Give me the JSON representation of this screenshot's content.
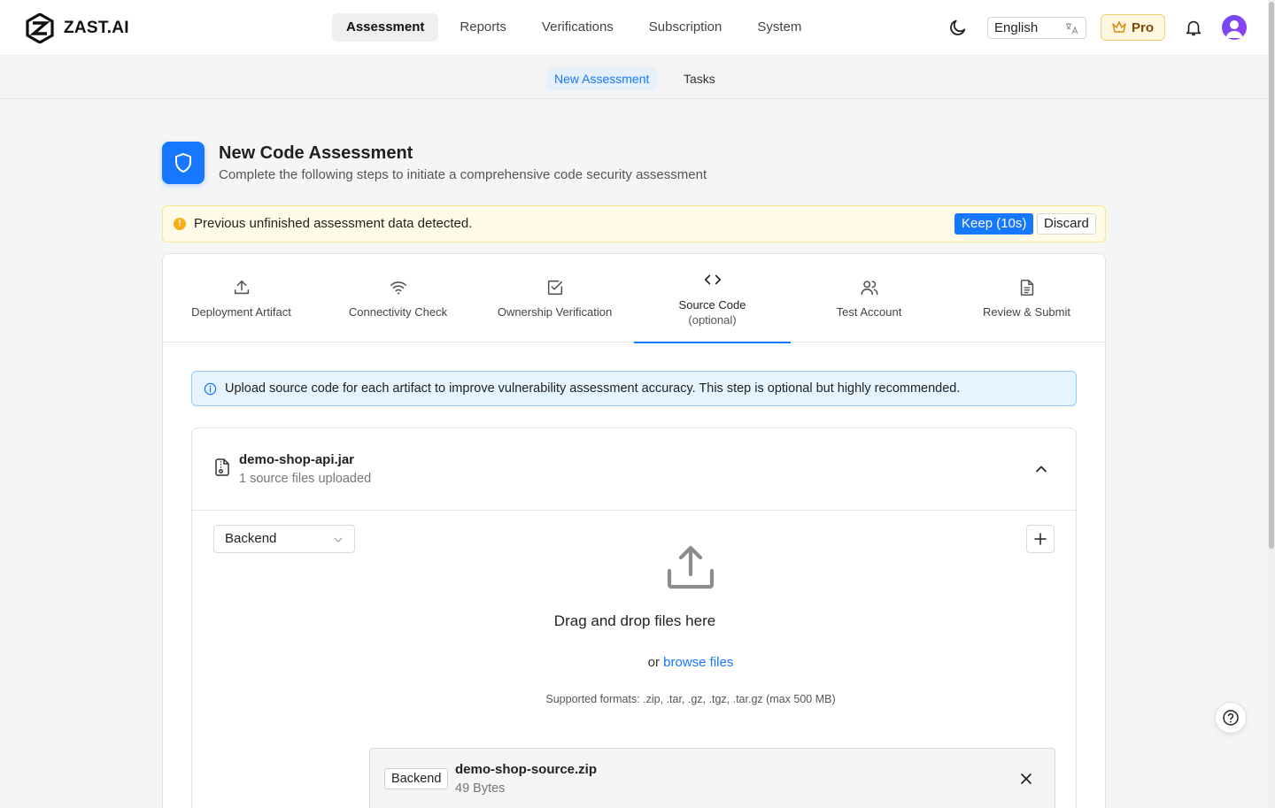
{
  "brand": {
    "name": "ZAST.AI"
  },
  "nav": [
    {
      "label": "Assessment",
      "active": true
    },
    {
      "label": "Reports"
    },
    {
      "label": "Verifications"
    },
    {
      "label": "Subscription"
    },
    {
      "label": "System"
    }
  ],
  "header_tools": {
    "language": "English",
    "plan": "Pro"
  },
  "subnav": [
    {
      "label": "New Assessment",
      "active": true
    },
    {
      "label": "Tasks"
    }
  ],
  "page": {
    "title": "New Code Assessment",
    "subtitle": "Complete the following steps to initiate a comprehensive code security assessment"
  },
  "warning": {
    "text": "Previous unfinished assessment data detected.",
    "keep_label": "Keep (10s)",
    "discard_label": "Discard"
  },
  "steps": [
    {
      "label": "Deployment Artifact",
      "icon": "upload-icon"
    },
    {
      "label": "Connectivity Check",
      "icon": "wifi-icon"
    },
    {
      "label": "Ownership Verification",
      "icon": "checkbox-icon"
    },
    {
      "label": "Source Code",
      "label2": "(optional)",
      "icon": "code-icon",
      "active": true
    },
    {
      "label": "Test Account",
      "icon": "users-icon"
    },
    {
      "label": "Review & Submit",
      "icon": "document-icon"
    }
  ],
  "info": {
    "text": "Upload source code for each artifact to improve vulnerability assessment accuracy. This step is optional but highly recommended."
  },
  "artifact": {
    "name": "demo-shop-api.jar",
    "count_text": "1 source files uploaded",
    "type_select": "Backend",
    "drag_text": "Drag and drop files here",
    "or_text": "or",
    "browse_label": "browse files",
    "formats_text": "Supported formats: .zip, .tar, .gz, .tgz, .tar.gz (max 500 MB)",
    "uploaded": {
      "tag": "Backend",
      "name": "demo-shop-source.zip",
      "size": "49 Bytes"
    }
  },
  "colors": {
    "accent": "#1677ff",
    "warning": "#faad14",
    "pro": "#f1cf73"
  }
}
